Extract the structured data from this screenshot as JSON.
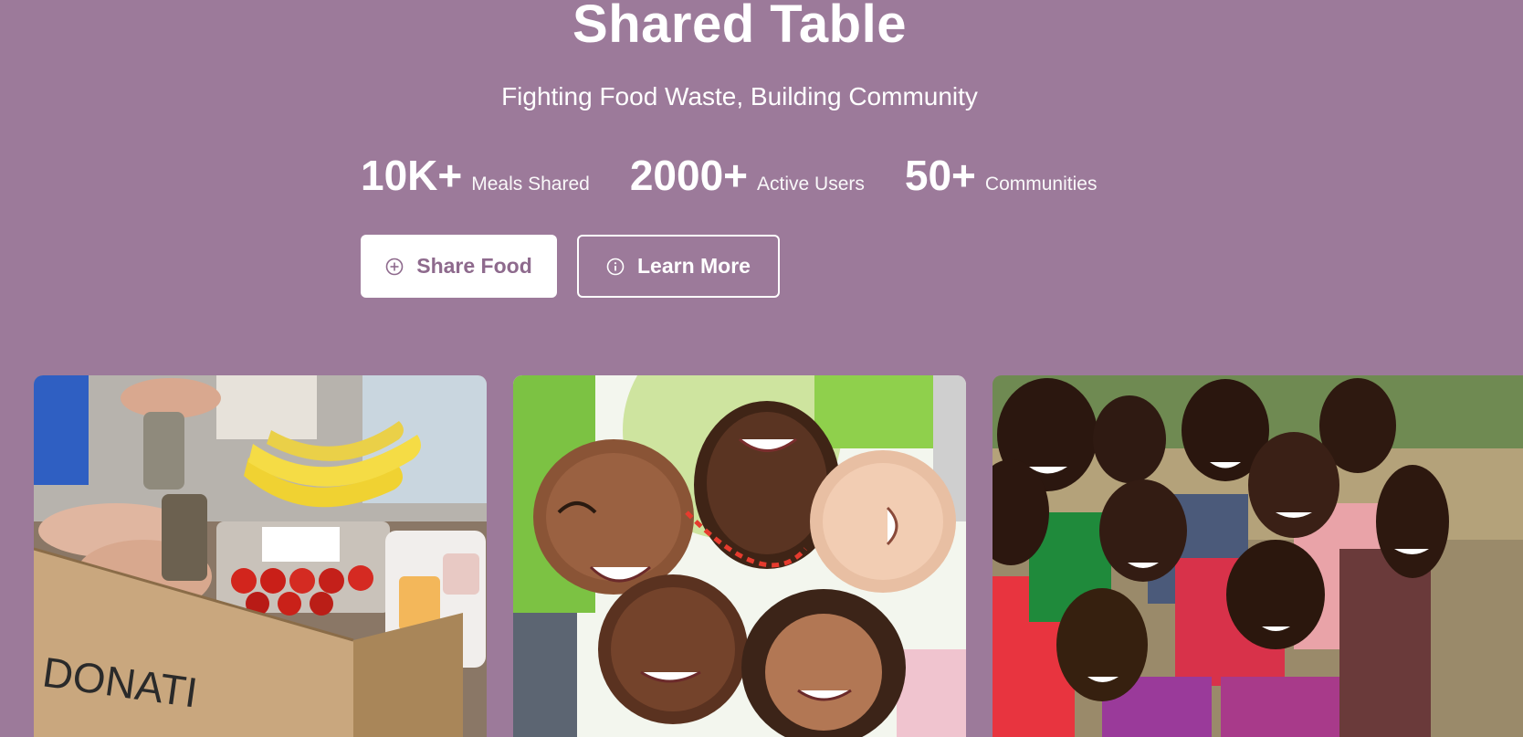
{
  "hero": {
    "title": "Shared Table",
    "subtitle": "Fighting Food Waste, Building Community"
  },
  "stats": [
    {
      "value": "10K+",
      "label": "Meals Shared"
    },
    {
      "value": "2000+",
      "label": "Active Users"
    },
    {
      "value": "50+",
      "label": "Communities"
    }
  ],
  "buttons": {
    "share_food": {
      "label": "Share Food",
      "icon": "plus-circle-icon"
    },
    "learn_more": {
      "label": "Learn More",
      "icon": "info-circle-icon"
    }
  },
  "gallery": {
    "images": [
      {
        "subject": "food donation box with bananas, tomatoes and canned goods",
        "box_text": "DONATI"
      },
      {
        "subject": "circle of smiling children looking down at camera"
      },
      {
        "subject": "group of smiling children outdoors"
      }
    ]
  },
  "colors": {
    "background": "#9c7a9a",
    "primary_button_bg": "#ffffff",
    "primary_button_text": "#8e6a8d",
    "text": "#ffffff"
  }
}
